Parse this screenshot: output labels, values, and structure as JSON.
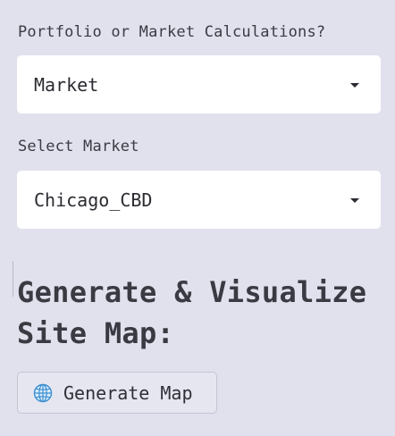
{
  "form": {
    "calc_label": "Portfolio or Market Calculations?",
    "calc_value": "Market",
    "market_label": "Select Market",
    "market_value": "Chicago_CBD"
  },
  "sitemap": {
    "heading_line1": "Generate & Visualize",
    "heading_line2": "Site Map:",
    "button_label": "Generate Map",
    "button_icon": "globe-icon"
  }
}
